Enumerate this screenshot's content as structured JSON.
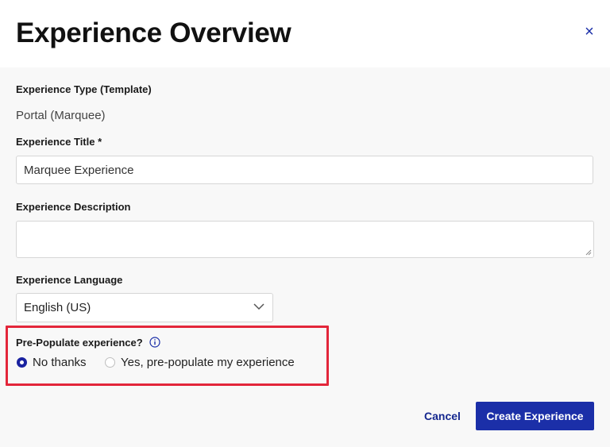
{
  "header": {
    "title": "Experience Overview",
    "close_glyph": "×"
  },
  "form": {
    "type_label": "Experience Type (Template)",
    "type_value": "Portal (Marquee)",
    "title_label": "Experience Title *",
    "title_value": "Marquee Experience",
    "description_label": "Experience Description",
    "description_value": "",
    "language_label": "Experience Language",
    "language_value": "English (US)",
    "prepopulate_label": "Pre-Populate experience?",
    "options": [
      {
        "label": "No thanks",
        "selected": true
      },
      {
        "label": "Yes, pre-populate my experience",
        "selected": false
      }
    ]
  },
  "footer": {
    "cancel_label": "Cancel",
    "create_label": "Create Experience"
  },
  "colors": {
    "accent": "#1b2fa8",
    "highlight": "#e3263a",
    "background": "#f8f8f8"
  },
  "icons": [
    "close-icon",
    "info-icon",
    "chevron-down-icon",
    "resize-handle-icon"
  ]
}
